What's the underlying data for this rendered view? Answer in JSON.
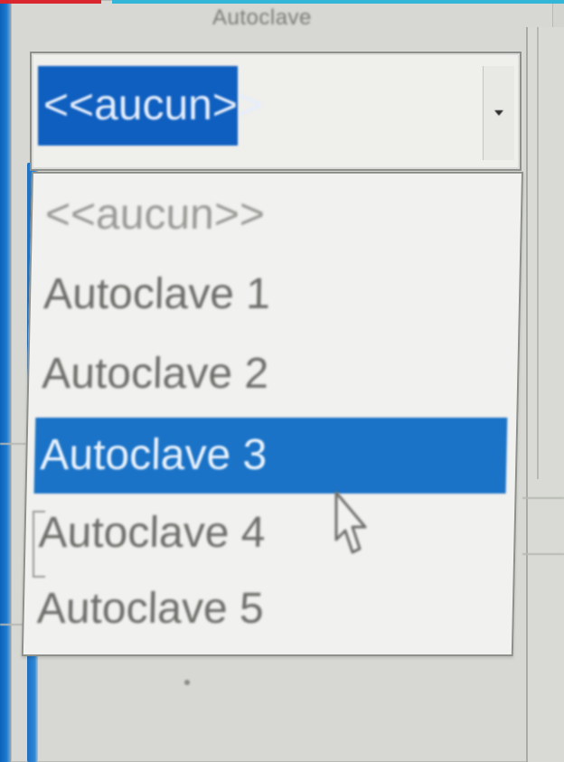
{
  "window": {
    "caption": "Autoclave"
  },
  "combobox": {
    "selected_value": "<<aucun>>"
  },
  "dropdown": {
    "items": [
      {
        "label": "<<aucun>>"
      },
      {
        "label": "Autoclave 1"
      },
      {
        "label": "Autoclave 2"
      },
      {
        "label": "Autoclave 3"
      },
      {
        "label": "Autoclave 4"
      },
      {
        "label": "Autoclave 5"
      }
    ],
    "highlighted_index": 3
  },
  "icons": {
    "dropdown_arrow": "chevron-down-icon",
    "mouse_pointer": "mouse-pointer-icon"
  },
  "colors": {
    "selection_blue": "#1a73c7",
    "window_border_blue": "#0a63b8"
  }
}
